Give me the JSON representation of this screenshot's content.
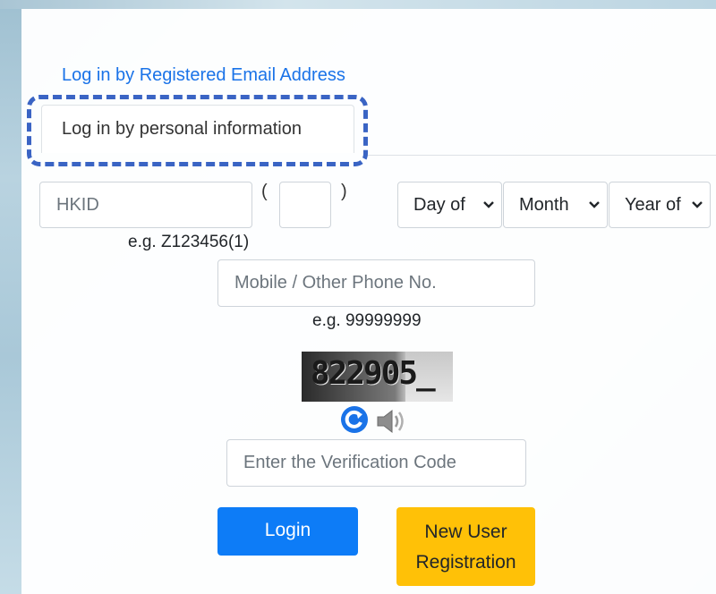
{
  "tabs": {
    "email_label": "Log in by Registered Email Address",
    "personal_label": "Log in by personal information"
  },
  "hkid": {
    "placeholder": "HKID",
    "open_paren": "(",
    "close_paren": ")",
    "example": "e.g. Z123456(1)"
  },
  "dob": {
    "day": "Day of",
    "month": "Month",
    "year": "Year of"
  },
  "phone": {
    "placeholder": "Mobile / Other Phone No.",
    "example": "e.g. 99999999"
  },
  "captcha": {
    "code": "822905_"
  },
  "verification": {
    "placeholder": "Enter the Verification Code"
  },
  "buttons": {
    "login": "Login",
    "register_line1": "New User",
    "register_line2": "Registration"
  },
  "colors": {
    "link": "#1a73e8",
    "login_bg": "#0d7cf7",
    "register_bg": "#ffc107",
    "highlight_border": "#3a64c4"
  },
  "icons": {
    "refresh": "refresh-icon",
    "speaker": "speaker-icon",
    "dropdown": "chevron-down-icon"
  }
}
